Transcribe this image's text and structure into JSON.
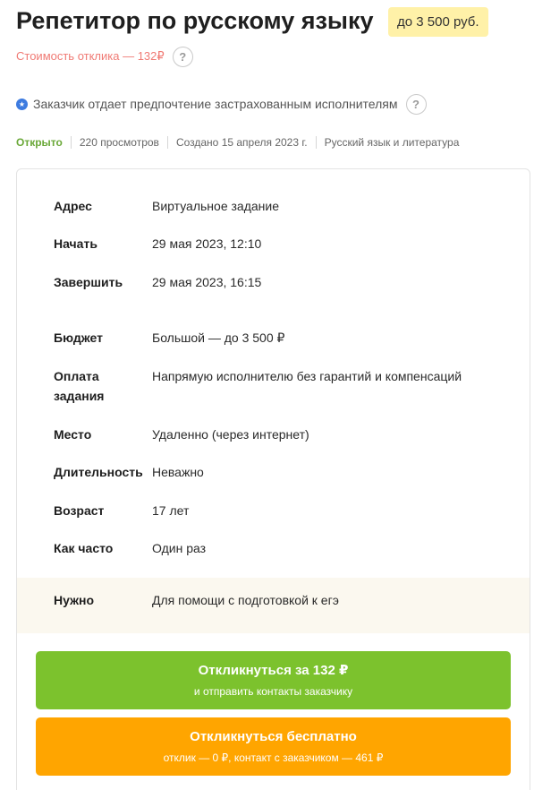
{
  "header": {
    "title": "Репетитор по русскому языку",
    "price_badge": "до 3 500 руб."
  },
  "cost": {
    "text": "Стоимость отклика — 132₽",
    "help_icon": "?"
  },
  "preference": {
    "text": "Заказчик отдает предпочтение застрахованным исполнителям",
    "help_icon": "?"
  },
  "meta": {
    "status": "Открыто",
    "views": "220 просмотров",
    "created": "Создано 15 апреля 2023 г.",
    "category": "Русский язык и литература"
  },
  "details": [
    {
      "label": "Адрес",
      "value": "Виртуальное задание"
    },
    {
      "label": "Начать",
      "value": "29 мая 2023, 12:10"
    },
    {
      "label": "Завершить",
      "value": "29 мая 2023, 16:15"
    },
    {
      "label": "Бюджет",
      "value": "Большой — до 3 500 ₽"
    },
    {
      "label": "Оплата задания",
      "value": "Напрямую исполнителю без гарантий и компенсаций"
    },
    {
      "label": "Место",
      "value": "Удаленно (через интернет)"
    },
    {
      "label": "Длительность",
      "value": "Неважно"
    },
    {
      "label": "Возраст",
      "value": "17 лет"
    },
    {
      "label": "Как часто",
      "value": "Один раз"
    },
    {
      "label": "Нужно",
      "value": "Для помощи с подготовкой к егэ"
    }
  ],
  "actions": {
    "paid_main": "Откликнуться за 132 ₽",
    "paid_sub": "и отправить контакты заказчику",
    "free_main": "Откликнуться бесплатно",
    "free_sub": "отклик — 0 ₽, контакт с заказчиком — 461 ₽"
  }
}
